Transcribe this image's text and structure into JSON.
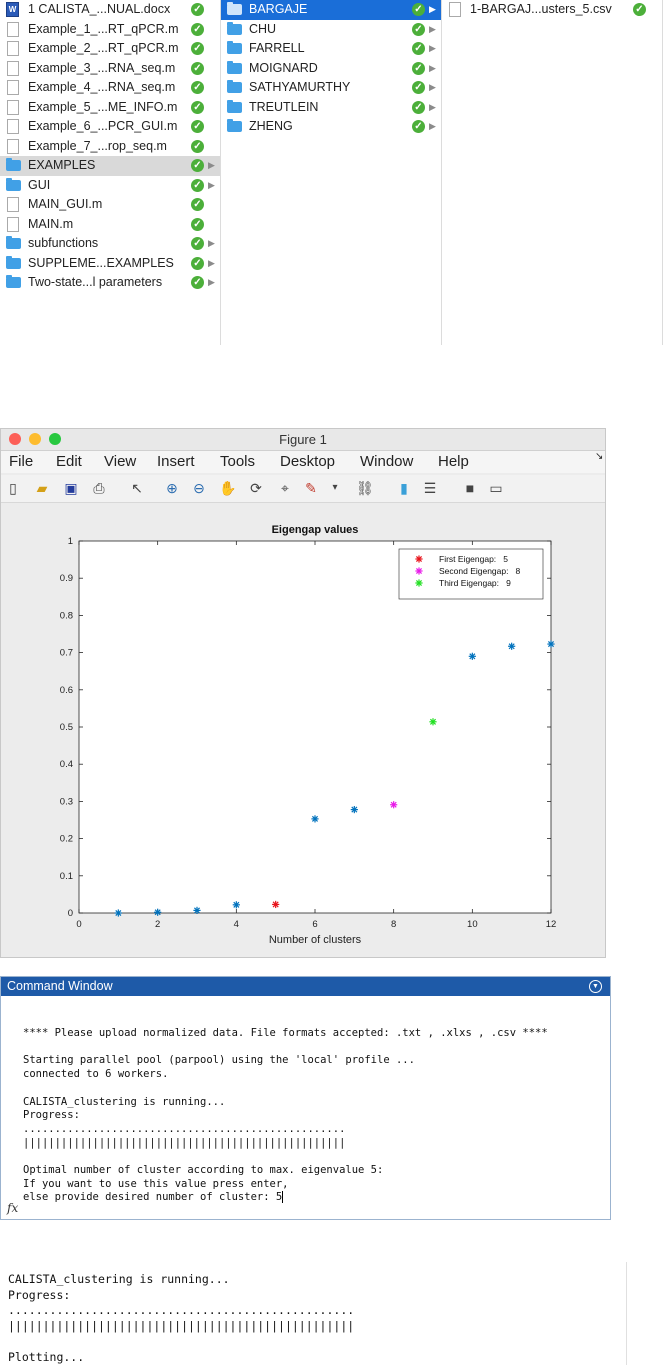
{
  "finder": {
    "column1": [
      {
        "name": "1 CALISTA_...NUAL.docx",
        "icon": "word-doc-icon",
        "check": true,
        "arrow": false
      },
      {
        "name": "Example_1_...RT_qPCR.m",
        "icon": "file-icon",
        "check": true,
        "arrow": false
      },
      {
        "name": "Example_2_...RT_qPCR.m",
        "icon": "file-icon",
        "check": true,
        "arrow": false
      },
      {
        "name": "Example_3_...RNA_seq.m",
        "icon": "file-icon",
        "check": true,
        "arrow": false
      },
      {
        "name": "Example_4_...RNA_seq.m",
        "icon": "file-icon",
        "check": true,
        "arrow": false
      },
      {
        "name": "Example_5_...ME_INFO.m",
        "icon": "file-icon",
        "check": true,
        "arrow": false
      },
      {
        "name": "Example_6_...PCR_GUI.m",
        "icon": "file-icon",
        "check": true,
        "arrow": false
      },
      {
        "name": "Example_7_...rop_seq.m",
        "icon": "file-icon",
        "check": true,
        "arrow": false
      },
      {
        "name": "EXAMPLES",
        "icon": "folder-icon",
        "check": true,
        "arrow": true,
        "selected": true
      },
      {
        "name": "GUI",
        "icon": "folder-icon",
        "check": true,
        "arrow": true
      },
      {
        "name": "MAIN_GUI.m",
        "icon": "file-icon",
        "check": true,
        "arrow": false
      },
      {
        "name": "MAIN.m",
        "icon": "file-icon",
        "check": true,
        "arrow": false
      },
      {
        "name": "subfunctions",
        "icon": "folder-icon",
        "check": true,
        "arrow": true
      },
      {
        "name": "SUPPLEME...EXAMPLES",
        "icon": "folder-icon",
        "check": true,
        "arrow": true
      },
      {
        "name": "Two-state...l parameters",
        "icon": "folder-icon",
        "check": true,
        "arrow": true
      }
    ],
    "column2": [
      {
        "name": "BARGAJE",
        "icon": "folder-icon",
        "selected": true
      },
      {
        "name": "CHU",
        "icon": "folder-icon"
      },
      {
        "name": "FARRELL",
        "icon": "folder-icon"
      },
      {
        "name": "MOIGNARD",
        "icon": "folder-icon"
      },
      {
        "name": "SATHYAMURTHY",
        "icon": "folder-icon"
      },
      {
        "name": "TREUTLEIN",
        "icon": "folder-icon"
      },
      {
        "name": "ZHENG",
        "icon": "folder-icon"
      }
    ],
    "column3": [
      {
        "name": "1-BARGAJ...usters_5.csv",
        "icon": "file-icon"
      }
    ]
  },
  "figure": {
    "window_title": "Figure 1",
    "menu": [
      "File",
      "Edit",
      "View",
      "Insert",
      "Tools",
      "Desktop",
      "Window",
      "Help"
    ],
    "toolbar_icons": [
      "new-figure-icon",
      "open-file-icon",
      "save-icon",
      "print-icon",
      "pointer-icon",
      "zoom-in-icon",
      "zoom-out-icon",
      "pan-icon",
      "rotate-icon",
      "data-cursor-icon",
      "brush-icon",
      "dropdown-icon",
      "link-icon",
      "colorbar-icon",
      "legend-icon",
      "hide-tools-icon",
      "dock-icon"
    ]
  },
  "chart_data": {
    "type": "scatter",
    "title": "Eigengap values",
    "xlabel": "Number of clusters",
    "ylabel": "",
    "xlim": [
      0,
      12
    ],
    "ylim": [
      0,
      1
    ],
    "xticks": [
      0,
      2,
      4,
      6,
      8,
      10,
      12
    ],
    "yticks": [
      0,
      0.1,
      0.2,
      0.3,
      0.4,
      0.5,
      0.6,
      0.7,
      0.8,
      0.9,
      1
    ],
    "ytick_labels": [
      "0",
      "0.1",
      "0.2",
      "0.3",
      "0.4",
      "0.5",
      "0.6",
      "0.7",
      "0.8",
      "0.9",
      "1"
    ],
    "legend_position": "top-right",
    "marker": "asterisk",
    "grid": false,
    "series": [
      {
        "color": "#0072bd",
        "points": [
          [
            1,
            0.0
          ],
          [
            2,
            0.002
          ],
          [
            3,
            0.007
          ],
          [
            4,
            0.022
          ],
          [
            6,
            0.253
          ],
          [
            7,
            0.278
          ],
          [
            10,
            0.69
          ],
          [
            11,
            0.717
          ],
          [
            12,
            0.723
          ]
        ]
      },
      {
        "name": "First Eigengap:   5",
        "color": "#e8141c",
        "points": [
          [
            5,
            0.023
          ]
        ]
      },
      {
        "name": "Second Eigengap:   8",
        "color": "#e81ce8",
        "points": [
          [
            8,
            0.291
          ]
        ]
      },
      {
        "name": "Third Eigengap:   9",
        "color": "#22e022",
        "points": [
          [
            9,
            0.514
          ]
        ]
      }
    ]
  },
  "command_window": {
    "title": "Command Window",
    "lines": [
      "**** Please upload normalized data. File formats accepted: .txt , .xlxs , .csv ****",
      "",
      "Starting parallel pool (parpool) using the 'local' profile ...",
      "connected to 6 workers.",
      "",
      "CALISTA_clustering is running...",
      "Progress:",
      "...................................................",
      "|||||||||||||||||||||||||||||||||||||||||||||||||||",
      "",
      "Optimal number of cluster according to max. eigenvalue 5:",
      "If you want to use this value press enter,",
      "else provide desired number of cluster: 5"
    ]
  },
  "output": {
    "lines": [
      "CALISTA_clustering is running...",
      "Progress:",
      "..................................................",
      "||||||||||||||||||||||||||||||||||||||||||||||||||",
      "",
      "Plotting..."
    ]
  }
}
